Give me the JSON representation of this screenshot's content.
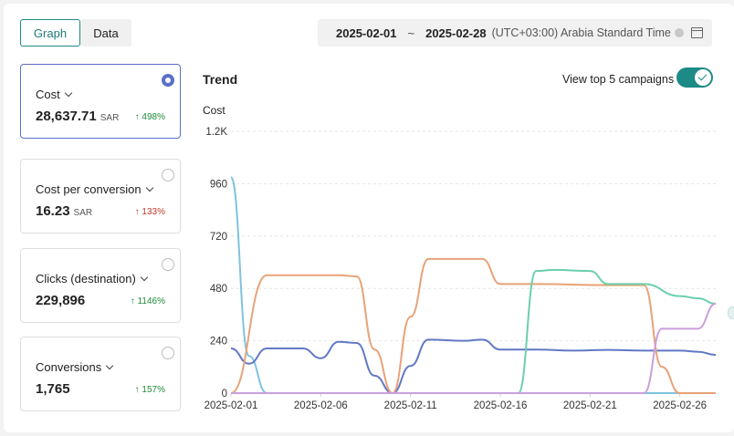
{
  "tabs": [
    {
      "label": "Graph",
      "active": true
    },
    {
      "label": "Data",
      "active": false
    }
  ],
  "daterange": {
    "start": "2025-02-01",
    "separator": "~",
    "end": "2025-02-28",
    "timezone": "(UTC+03:00) Arabia Standard Time",
    "info_icon": "info-icon",
    "calendar_icon": "calendar-icon"
  },
  "metrics": [
    {
      "title": "Cost",
      "value": "28,637.71",
      "unit": "SAR",
      "change": "498%",
      "direction": "up",
      "selected": true
    },
    {
      "title": "Cost per conversion",
      "value": "16.23",
      "unit": "SAR",
      "change": "133%",
      "direction": "up-bad",
      "selected": false
    },
    {
      "title": "Clicks (destination)",
      "value": "229,896",
      "unit": "",
      "change": "1146%",
      "direction": "up",
      "selected": false
    },
    {
      "title": "Conversions",
      "value": "1,765",
      "unit": "",
      "change": "157%",
      "direction": "up",
      "selected": false
    }
  ],
  "trend": {
    "title": "Trend",
    "toggle_label": "View top 5 campaigns",
    "toggle_on": true
  },
  "colors": {
    "accent": "#1d8a86",
    "selected": "#5b6fc7",
    "up": "#1f8a3a",
    "down": "#c0392b"
  },
  "chart_data": {
    "type": "line",
    "ylabel": "Cost",
    "ylim": [
      0,
      1200
    ],
    "y_ticks": [
      0,
      240,
      480,
      720,
      960,
      1200
    ],
    "y_tick_labels": [
      "0",
      "240",
      "480",
      "720",
      "960",
      "1.2K"
    ],
    "x_domain": [
      "2025-02-01",
      "2025-02-28"
    ],
    "x_ticks": [
      "2025-02-01",
      "2025-02-06",
      "2025-02-11",
      "2025-02-16",
      "2025-02-21",
      "2025-02-26"
    ],
    "grid": true,
    "series": [
      {
        "color": "#7fc3df",
        "points": [
          [
            "2025-02-01",
            990
          ],
          [
            "2025-02-02",
            170
          ],
          [
            "2025-02-03",
            0
          ],
          [
            "2025-02-28",
            0
          ]
        ]
      },
      {
        "color": "#6278c6",
        "points": [
          [
            "2025-02-01",
            205
          ],
          [
            "2025-02-02",
            135
          ],
          [
            "2025-02-03",
            205
          ],
          [
            "2025-02-05",
            205
          ],
          [
            "2025-02-06",
            160
          ],
          [
            "2025-02-07",
            235
          ],
          [
            "2025-02-08",
            230
          ],
          [
            "2025-02-09",
            80
          ],
          [
            "2025-02-10",
            0
          ],
          [
            "2025-02-11",
            125
          ],
          [
            "2025-02-12",
            245
          ],
          [
            "2025-02-14",
            240
          ],
          [
            "2025-02-15",
            245
          ],
          [
            "2025-02-16",
            200
          ],
          [
            "2025-02-18",
            200
          ],
          [
            "2025-02-20",
            195
          ],
          [
            "2025-02-22",
            198
          ],
          [
            "2025-02-24",
            195
          ],
          [
            "2025-02-26",
            195
          ],
          [
            "2025-02-27",
            190
          ],
          [
            "2025-02-28",
            175
          ]
        ]
      },
      {
        "color": "#e8a277",
        "points": [
          [
            "2025-02-01",
            0
          ],
          [
            "2025-02-03",
            540
          ],
          [
            "2025-02-04",
            540
          ],
          [
            "2025-02-07",
            540
          ],
          [
            "2025-02-08",
            535
          ],
          [
            "2025-02-09",
            200
          ],
          [
            "2025-02-10",
            0
          ],
          [
            "2025-02-11",
            350
          ],
          [
            "2025-02-12",
            615
          ],
          [
            "2025-02-14",
            615
          ],
          [
            "2025-02-15",
            615
          ],
          [
            "2025-02-16",
            500
          ],
          [
            "2025-02-18",
            500
          ],
          [
            "2025-02-22",
            495
          ],
          [
            "2025-02-24",
            495
          ],
          [
            "2025-02-25",
            120
          ],
          [
            "2025-02-26",
            0
          ],
          [
            "2025-02-28",
            0
          ]
        ]
      },
      {
        "color": "#6bcfaa",
        "points": [
          [
            "2025-02-01",
            0
          ],
          [
            "2025-02-17",
            0
          ],
          [
            "2025-02-18",
            560
          ],
          [
            "2025-02-19",
            565
          ],
          [
            "2025-02-21",
            560
          ],
          [
            "2025-02-22",
            500
          ],
          [
            "2025-02-24",
            500
          ],
          [
            "2025-02-26",
            445
          ],
          [
            "2025-02-27",
            435
          ],
          [
            "2025-02-28",
            410
          ]
        ]
      },
      {
        "color": "#c9a0dc",
        "points": [
          [
            "2025-02-01",
            0
          ],
          [
            "2025-02-24",
            0
          ],
          [
            "2025-02-25",
            295
          ],
          [
            "2025-02-27",
            295
          ],
          [
            "2025-02-28",
            410
          ]
        ]
      }
    ]
  }
}
